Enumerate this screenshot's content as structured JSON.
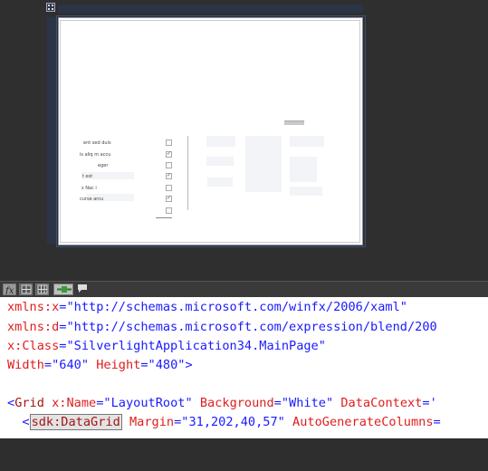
{
  "design_surface": {
    "datagrid_rows": [
      {
        "text": "ent sed duis",
        "checked": false
      },
      {
        "text": "is aliq  m accu",
        "checked": true
      },
      {
        "text": "eger",
        "checked": false
      },
      {
        "text": "t est",
        "checked": true
      },
      {
        "text": "s Nac i",
        "checked": false
      },
      {
        "text": "curse arcu",
        "checked": true
      },
      {
        "text": "",
        "checked": false
      }
    ]
  },
  "toolbar": {
    "buttons": [
      "zoom-icon",
      "grid-icon",
      "table-icon",
      "snap-icon",
      "annotation-icon"
    ]
  },
  "code": {
    "l1_attr": "xmlns:x",
    "l1_eq": "=",
    "l1_val": "\"http://schemas.microsoft.com/winfx/2006/xaml\"",
    "l2_attr": "xmlns:d",
    "l2_eq": "=",
    "l2_val": "\"http://schemas.microsoft.com/expression/blend/200",
    "l3_attr": "x:Class",
    "l3_eq": "=",
    "l3_val": "\"SilverlightApplication34.MainPage\"",
    "l4_attr1": "Width",
    "l4_eq1": "=",
    "l4_val1": "\"640\"",
    "l4_attr2": "Height",
    "l4_eq2": "=",
    "l4_val2": "\"480\"",
    "l4_end": ">",
    "l5_open": "<",
    "l5_tag": "Grid",
    "l5_attr1": "x:Name",
    "l5_eq1": "=",
    "l5_val1": "\"LayoutRoot\"",
    "l5_attr2": "Background",
    "l5_eq2": "=",
    "l5_val2": "\"White\"",
    "l5_attr3": "DataContext",
    "l5_eq3": "=",
    "l5_val3": "'",
    "l6_indent": "  ",
    "l6_open": "<",
    "l6_tag": "sdk:DataGrid",
    "l6_attr1": "Margin",
    "l6_eq1": "=",
    "l6_val1": "\"31,202,40,57\"",
    "l6_attr2": "AutoGenerateColumns",
    "l6_eq2": "="
  },
  "colors": {
    "attribute": "#e01d1d",
    "value": "#1a1aff",
    "tag": "#a31515",
    "surface": "#2f2f2f",
    "ruler": "#2b3547"
  }
}
